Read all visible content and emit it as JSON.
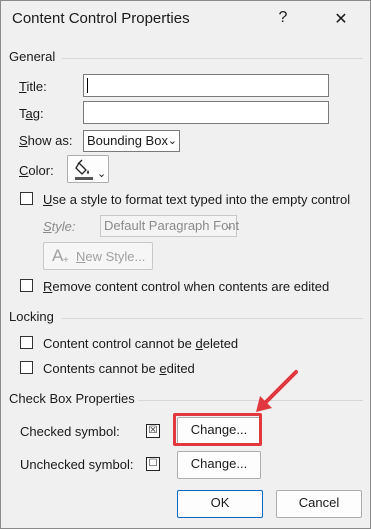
{
  "window": {
    "title": "Content Control Properties",
    "help_glyph": "?",
    "close_glyph": "✕"
  },
  "general": {
    "heading": "General",
    "title_label": "Title:",
    "title_value": "",
    "tag_label": "Tag:",
    "tag_value": "",
    "show_as_label": "Show as:",
    "show_as_value": "Bounding Box",
    "color_label": "Color:",
    "use_style_label": "Use a style to format text typed into the empty control",
    "use_style_checked": false,
    "style_label": "Style:",
    "style_value": "Default Paragraph Font",
    "new_style_label": "New Style...",
    "remove_label": "Remove content control when contents are edited",
    "remove_checked": false
  },
  "locking": {
    "heading": "Locking",
    "cannot_delete_label": "Content control cannot be deleted",
    "cannot_delete_checked": false,
    "cannot_edit_label": "Contents cannot be edited",
    "cannot_edit_checked": false
  },
  "checkbox_props": {
    "heading": "Check Box Properties",
    "checked_label": "Checked symbol:",
    "checked_symbol": "☒",
    "unchecked_label": "Unchecked symbol:",
    "unchecked_symbol": "☐",
    "change_label": "Change..."
  },
  "footer": {
    "ok_label": "OK",
    "cancel_label": "Cancel"
  },
  "colors": {
    "annotation_red": "#e0383e",
    "accent_blue": "#0067c0"
  }
}
